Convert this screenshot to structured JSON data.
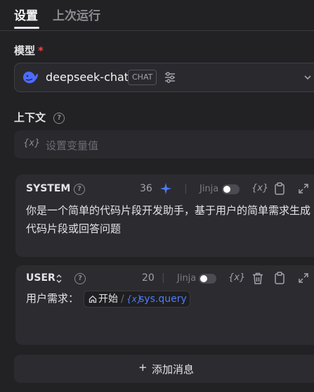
{
  "tabs": {
    "active": "设置",
    "inactive": "上次运行"
  },
  "model": {
    "label": "模型",
    "required_mark": "*",
    "name": "deepseek-chat",
    "tag": "CHAT",
    "brand_color": "#4d6bfe"
  },
  "context": {
    "label": "上下文",
    "help_glyph": "?",
    "var_icon_text": "{x}",
    "placeholder": "设置变量值"
  },
  "system": {
    "title": "SYSTEM",
    "count": "36",
    "separator": "|",
    "jinja_label": "Jinja",
    "var_text": "{x}",
    "content": "你是一个简单的代码片段开发助手，基于用户的简单需求生成代码片段或回答问题"
  },
  "user": {
    "title": "USER",
    "count": "20",
    "separator": "|",
    "jinja_label": "Jinja",
    "var_text": "{x}",
    "prefix": "用户需求：",
    "start_label": "开始",
    "slash": "/",
    "var_prefix": "{x}",
    "var_name": "sys.query"
  },
  "add_message": {
    "plus": "+",
    "label": "添加消息"
  },
  "colors": {
    "accent": "#4d7cff",
    "required": "#ef4444"
  }
}
